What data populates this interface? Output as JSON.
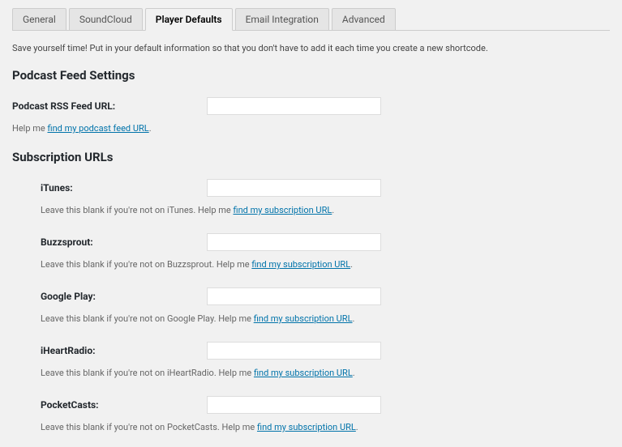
{
  "tabs": [
    {
      "label": "General"
    },
    {
      "label": "SoundCloud"
    },
    {
      "label": "Player Defaults"
    },
    {
      "label": "Email Integration"
    },
    {
      "label": "Advanced"
    }
  ],
  "intro": "Save yourself time! Put in your default information so that you don't have to add it each time you create a new shortcode.",
  "feed": {
    "heading": "Podcast Feed Settings",
    "label": "Podcast RSS Feed URL:",
    "help_prefix": "Help me ",
    "help_link": "find my podcast feed URL",
    "help_suffix": "."
  },
  "subs": {
    "heading": "Subscription URLs",
    "items": [
      {
        "label": "iTunes:",
        "help_prefix": "Leave this blank if you're not on iTunes. Help me ",
        "help_link": "find my subscription URL",
        "help_suffix": "."
      },
      {
        "label": "Buzzsprout:",
        "help_prefix": "Leave this blank if you're not on Buzzsprout. Help me ",
        "help_link": "find my subscription URL",
        "help_suffix": "."
      },
      {
        "label": "Google Play:",
        "help_prefix": "Leave this blank if you're not on Google Play. Help me ",
        "help_link": "find my subscription URL",
        "help_suffix": "."
      },
      {
        "label": "iHeartRadio:",
        "help_prefix": "Leave this blank if you're not on iHeartRadio. Help me ",
        "help_link": "find my subscription URL",
        "help_suffix": "."
      },
      {
        "label": "PocketCasts:",
        "help_prefix": "Leave this blank if you're not on PocketCasts. Help me ",
        "help_link": "find my subscription URL",
        "help_suffix": "."
      }
    ]
  }
}
